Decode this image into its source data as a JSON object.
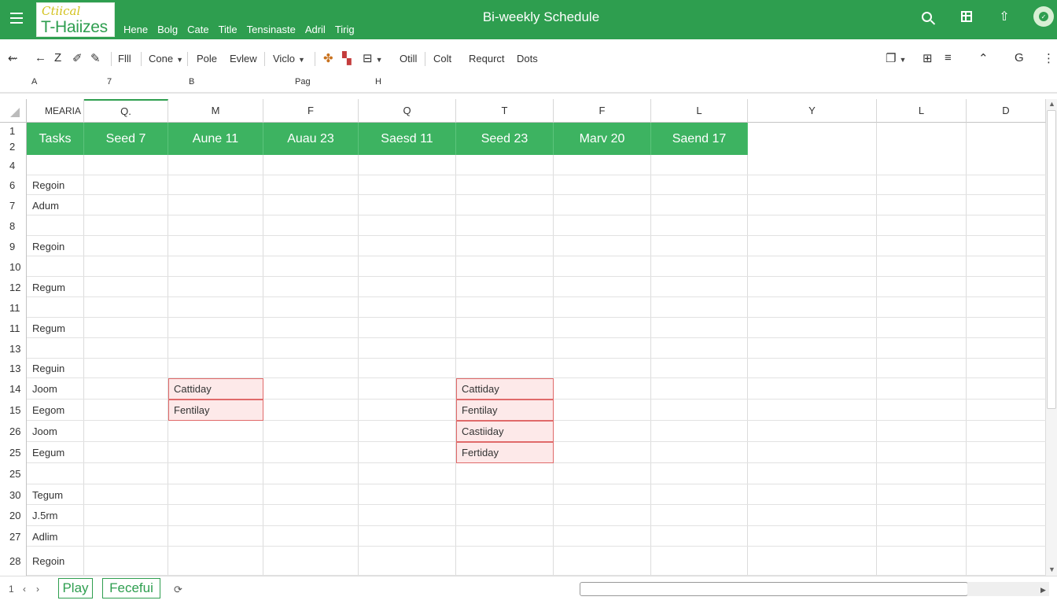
{
  "app": {
    "logo_top": "Ctiical",
    "logo_bottom": "T-Haiizes",
    "title": "Bi-weekly Schedule",
    "menu": [
      "Hene",
      "Bolg",
      "Cate",
      "Title",
      "Tensinaste",
      "Adril",
      "Tirig"
    ],
    "colors": {
      "brand": "#2e9e4f",
      "header_row": "#3db361",
      "event_fill": "#fde9e9",
      "event_border": "#e06a6a"
    },
    "icons": [
      "menu-icon",
      "search-icon",
      "grid-icon",
      "share-icon",
      "avatar"
    ]
  },
  "toolbar": {
    "items": [
      "Flll",
      "Cone",
      "Pole",
      "Evlew",
      "Viclo",
      "Otill",
      "Colt",
      "Requrct",
      "Dots"
    ],
    "icon_glyphs": {
      "back": "⇜",
      "undo": "←",
      "z": "Z",
      "pen": "✐",
      "brush": "✎",
      "paint": "✤",
      "paint2": "▚",
      "table": "⊟",
      "doc": "❐",
      "grid": "⊞",
      "lines": "≡",
      "caret_up": "⌃",
      "g": "G",
      "more": "⋮"
    }
  },
  "namerow": {
    "a": "A",
    "seven": "7",
    "b": "B",
    "pag": "Pag",
    "h": "H"
  },
  "columns": [
    "MEARIA",
    "Q.",
    "M",
    "F",
    "Q",
    "T",
    "F",
    "L",
    "Y",
    "L",
    "D"
  ],
  "header_row": [
    "Tasks",
    "Seed 7",
    "Aune 11",
    "Auau 23",
    "Saesd 11",
    "Seed 23",
    "Marv 20",
    "Saend 17"
  ],
  "rows": [
    {
      "num": "1"
    },
    {
      "num": "2"
    },
    {
      "num": "4",
      "task": ""
    },
    {
      "num": "6",
      "task": "Regoin"
    },
    {
      "num": "7",
      "task": "Adum"
    },
    {
      "num": "8",
      "task": ""
    },
    {
      "num": "9",
      "task": "Regoin"
    },
    {
      "num": "10",
      "task": ""
    },
    {
      "num": "12",
      "task": "Regum"
    },
    {
      "num": "11",
      "task": ""
    },
    {
      "num": "11",
      "task": "Regum"
    },
    {
      "num": "13",
      "task": ""
    },
    {
      "num": "13",
      "task": "Reguin"
    },
    {
      "num": "14",
      "task": "Joom"
    },
    {
      "num": "15",
      "task": "Eegom"
    },
    {
      "num": "26",
      "task": "Joom"
    },
    {
      "num": "25",
      "task": "Eegum"
    },
    {
      "num": "25",
      "task": ""
    },
    {
      "num": "30",
      "task": "Tegum"
    },
    {
      "num": "20",
      "task": "J.5rm"
    },
    {
      "num": "27",
      "task": "Adlim"
    },
    {
      "num": "28",
      "task": "Regoin"
    }
  ],
  "events": {
    "col_m": [
      "Cattiday",
      "Fentilay"
    ],
    "col_t": [
      "Cattiday",
      "Fentilay",
      "Castiiday",
      "Fertiday"
    ]
  },
  "sheets": {
    "page": "1",
    "prev": "‹",
    "next": "›",
    "tabs": [
      "Play",
      "Fecefui"
    ],
    "scroll_glyph": "⟳"
  }
}
